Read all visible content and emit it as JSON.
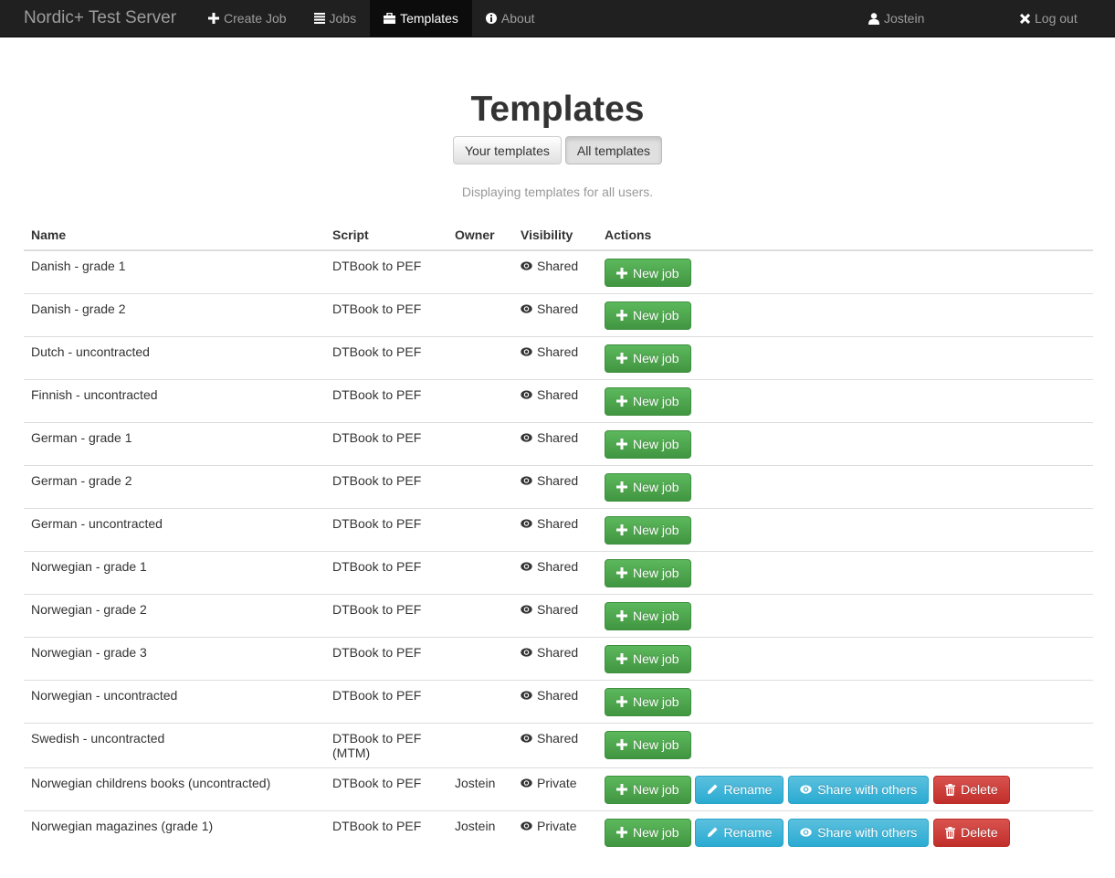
{
  "navbar": {
    "brand": "Nordic+ Test Server",
    "items": [
      {
        "label": "Create Job",
        "icon": "plus-icon",
        "active": false
      },
      {
        "label": "Jobs",
        "icon": "list-icon",
        "active": false
      },
      {
        "label": "Templates",
        "icon": "briefcase-icon",
        "active": true
      },
      {
        "label": "About",
        "icon": "info-icon",
        "active": false
      }
    ],
    "user": {
      "label": "Jostein",
      "icon": "user-icon"
    },
    "logout": {
      "label": "Log out",
      "icon": "close-icon"
    }
  },
  "page": {
    "title": "Templates",
    "toggle": [
      {
        "label": "Your templates",
        "active": false
      },
      {
        "label": "All templates",
        "active": true
      }
    ],
    "subtitle": "Displaying templates for all users."
  },
  "table": {
    "headers": {
      "name": "Name",
      "script": "Script",
      "owner": "Owner",
      "visibility": "Visibility",
      "actions": "Actions"
    },
    "rows": [
      {
        "name": "Danish - grade 1",
        "script": "DTBook to PEF",
        "owner": "",
        "visibility": "Shared",
        "own": false
      },
      {
        "name": "Danish - grade 2",
        "script": "DTBook to PEF",
        "owner": "",
        "visibility": "Shared",
        "own": false
      },
      {
        "name": "Dutch - uncontracted",
        "script": "DTBook to PEF",
        "owner": "",
        "visibility": "Shared",
        "own": false
      },
      {
        "name": "Finnish - uncontracted",
        "script": "DTBook to PEF",
        "owner": "",
        "visibility": "Shared",
        "own": false
      },
      {
        "name": "German - grade 1",
        "script": "DTBook to PEF",
        "owner": "",
        "visibility": "Shared",
        "own": false
      },
      {
        "name": "German - grade 2",
        "script": "DTBook to PEF",
        "owner": "",
        "visibility": "Shared",
        "own": false
      },
      {
        "name": "German - uncontracted",
        "script": "DTBook to PEF",
        "owner": "",
        "visibility": "Shared",
        "own": false
      },
      {
        "name": "Norwegian - grade 1",
        "script": "DTBook to PEF",
        "owner": "",
        "visibility": "Shared",
        "own": false
      },
      {
        "name": "Norwegian - grade 2",
        "script": "DTBook to PEF",
        "owner": "",
        "visibility": "Shared",
        "own": false
      },
      {
        "name": "Norwegian - grade 3",
        "script": "DTBook to PEF",
        "owner": "",
        "visibility": "Shared",
        "own": false
      },
      {
        "name": "Norwegian - uncontracted",
        "script": "DTBook to PEF",
        "owner": "",
        "visibility": "Shared",
        "own": false
      },
      {
        "name": "Swedish - uncontracted",
        "script": "DTBook to PEF (MTM)",
        "owner": "",
        "visibility": "Shared",
        "own": false
      },
      {
        "name": "Norwegian childrens books (uncontracted)",
        "script": "DTBook to PEF",
        "owner": "Jostein",
        "visibility": "Private",
        "own": true
      },
      {
        "name": "Norwegian magazines (grade 1)",
        "script": "DTBook to PEF",
        "owner": "Jostein",
        "visibility": "Private",
        "own": true
      }
    ],
    "buttons": {
      "new_job": "New job",
      "rename": "Rename",
      "share": "Share with others",
      "delete": "Delete"
    }
  }
}
